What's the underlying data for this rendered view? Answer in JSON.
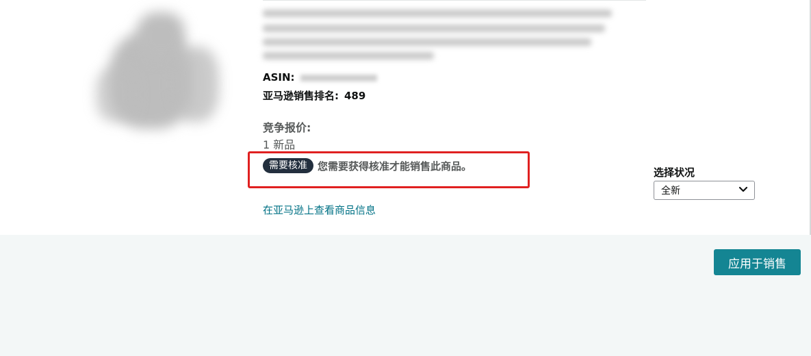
{
  "product": {
    "asin_label": "ASIN:",
    "rank_label": "亚马逊销售排名:",
    "rank_value": "489"
  },
  "offers": {
    "label": "竞争报价:",
    "count_text": "1 新品"
  },
  "approval": {
    "badge": "需要核准",
    "message": "您需要获得核准才能销售此商品。"
  },
  "link": {
    "view_on_amazon": "在亚马逊上查看商品信息"
  },
  "condition": {
    "label": "选择状况",
    "selected": "全新",
    "icon": "chevron-down-icon"
  },
  "actions": {
    "apply_label": "应用于销售"
  },
  "colors": {
    "accent_button": "#148593",
    "link": "#007185",
    "badge_bg": "#232f3e",
    "highlight_border": "#e02020",
    "page_bg": "#f3f7f7"
  }
}
